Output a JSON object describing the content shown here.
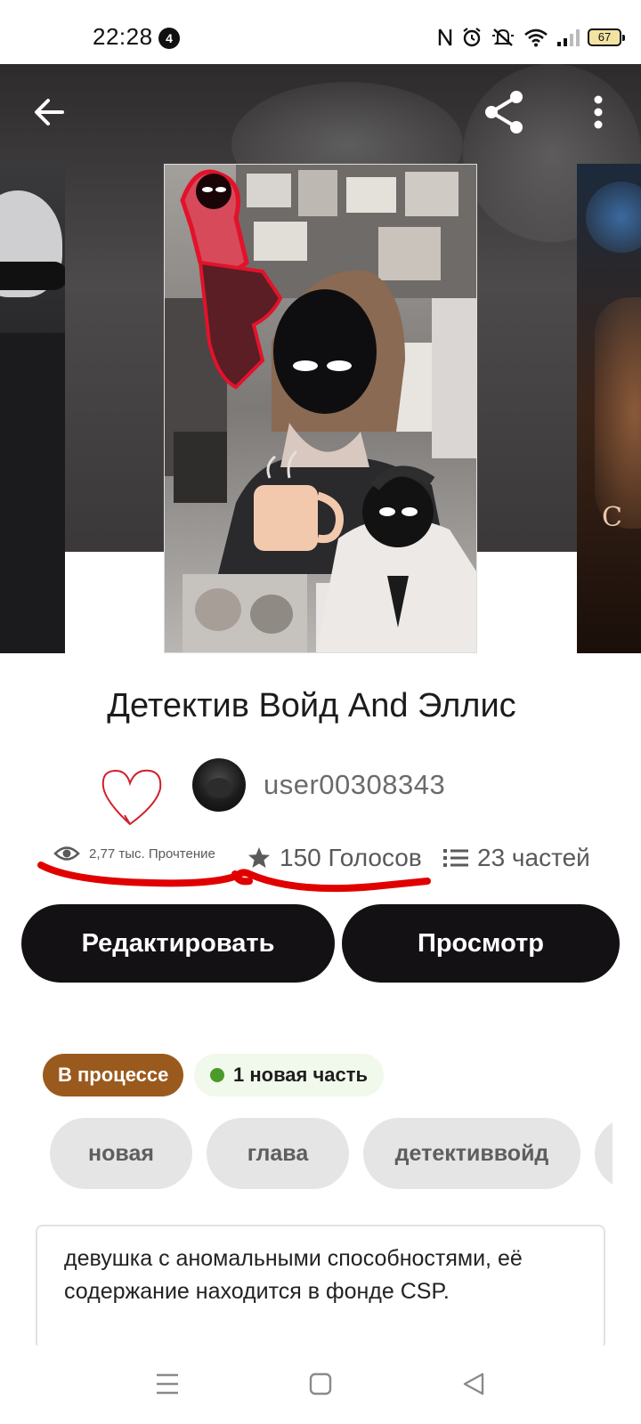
{
  "status_bar": {
    "time": "22:28",
    "notification_count": "4",
    "battery": "67"
  },
  "book": {
    "title": "Детектив Войд And Эллис",
    "author": "user00308343",
    "reads": "2,77 тыс. Прочтение",
    "votes": "150 Голосов",
    "parts": "23 частей"
  },
  "actions": {
    "edit_label": "Редактировать",
    "view_label": "Просмотр"
  },
  "status": {
    "progress_label": "В процессе",
    "new_part_label": "1 новая часть"
  },
  "tags": [
    "новая",
    "глава",
    "детективвойд"
  ],
  "description": {
    "line1": "девушка с  аномальными способностями, её",
    "line2": "содержание находится в фонде CSP."
  },
  "colors": {
    "button_dark": "#141114",
    "status_tag": "#9a5a1e",
    "new_dot": "#4c9a2a",
    "annotation_red": "#e00000"
  },
  "icons": [
    "back-arrow-icon",
    "share-icon",
    "more-vertical-icon",
    "heart-icon",
    "eye-icon",
    "star-icon",
    "list-icon",
    "menu-icon",
    "home-square-icon",
    "back-triangle-icon"
  ]
}
